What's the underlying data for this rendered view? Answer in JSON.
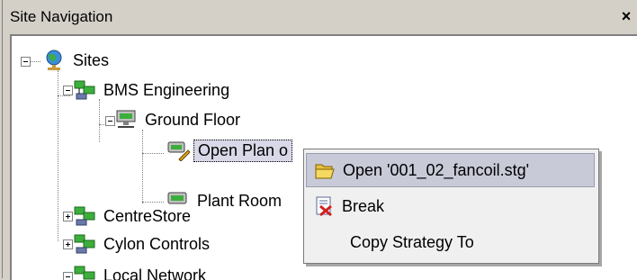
{
  "panel": {
    "title": "Site Navigation",
    "close_label": "×"
  },
  "tree": {
    "sites": "Sites",
    "bms": "BMS Engineering",
    "ground": "Ground Floor",
    "open_plan": "Open Plan o",
    "plant_room": "Plant Room",
    "centrestore": "CentreStore",
    "cylon": "Cylon Controls",
    "local": "Local Network"
  },
  "context_menu": {
    "items": [
      {
        "label": "Open '001_02_fancoil.stg'",
        "icon": "folder-open-icon",
        "highlighted": true
      },
      {
        "label": "Break",
        "icon": "break-icon"
      },
      {
        "label": "Copy Strategy To"
      }
    ]
  }
}
